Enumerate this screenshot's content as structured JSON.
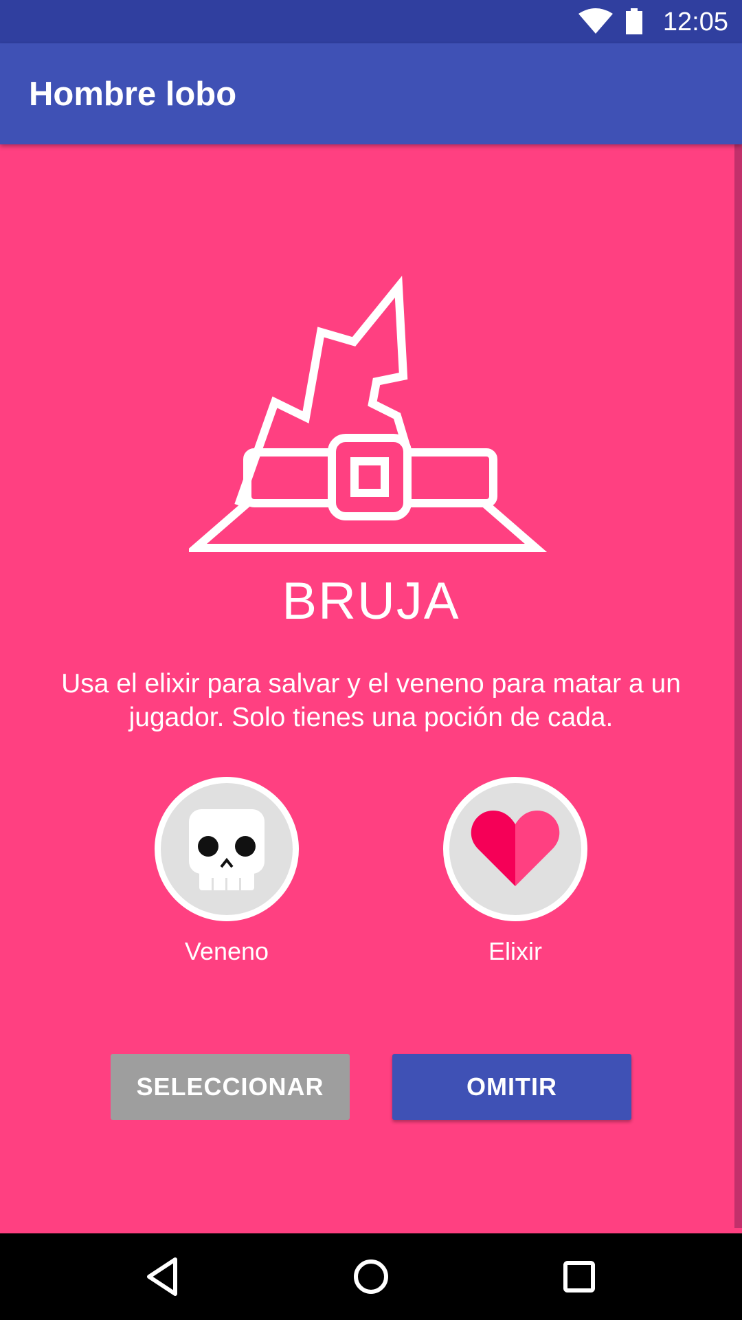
{
  "status_bar": {
    "time": "12:05",
    "background": "#303f9f",
    "icons": [
      "wifi-icon",
      "battery-icon"
    ]
  },
  "app_bar": {
    "title": "Hombre lobo",
    "background": "#3f51b5"
  },
  "role": {
    "icon": "witch-hat-icon",
    "name": "BRUJA",
    "description": "Usa el elixir para salvar y el veneno para matar a un jugador. Solo tienes una poción de cada.",
    "background": "#ff4081"
  },
  "potions": [
    {
      "icon": "skull-icon",
      "label": "Veneno"
    },
    {
      "icon": "heart-icon",
      "label": "Elixir"
    }
  ],
  "actions": {
    "select_label": "SELECCIONAR",
    "skip_label": "OMITIR",
    "select_color": "#9e9e9e",
    "skip_color": "#3f51b5"
  },
  "nav_bar": {
    "icons": [
      "back-icon",
      "home-icon",
      "recents-icon"
    ]
  }
}
